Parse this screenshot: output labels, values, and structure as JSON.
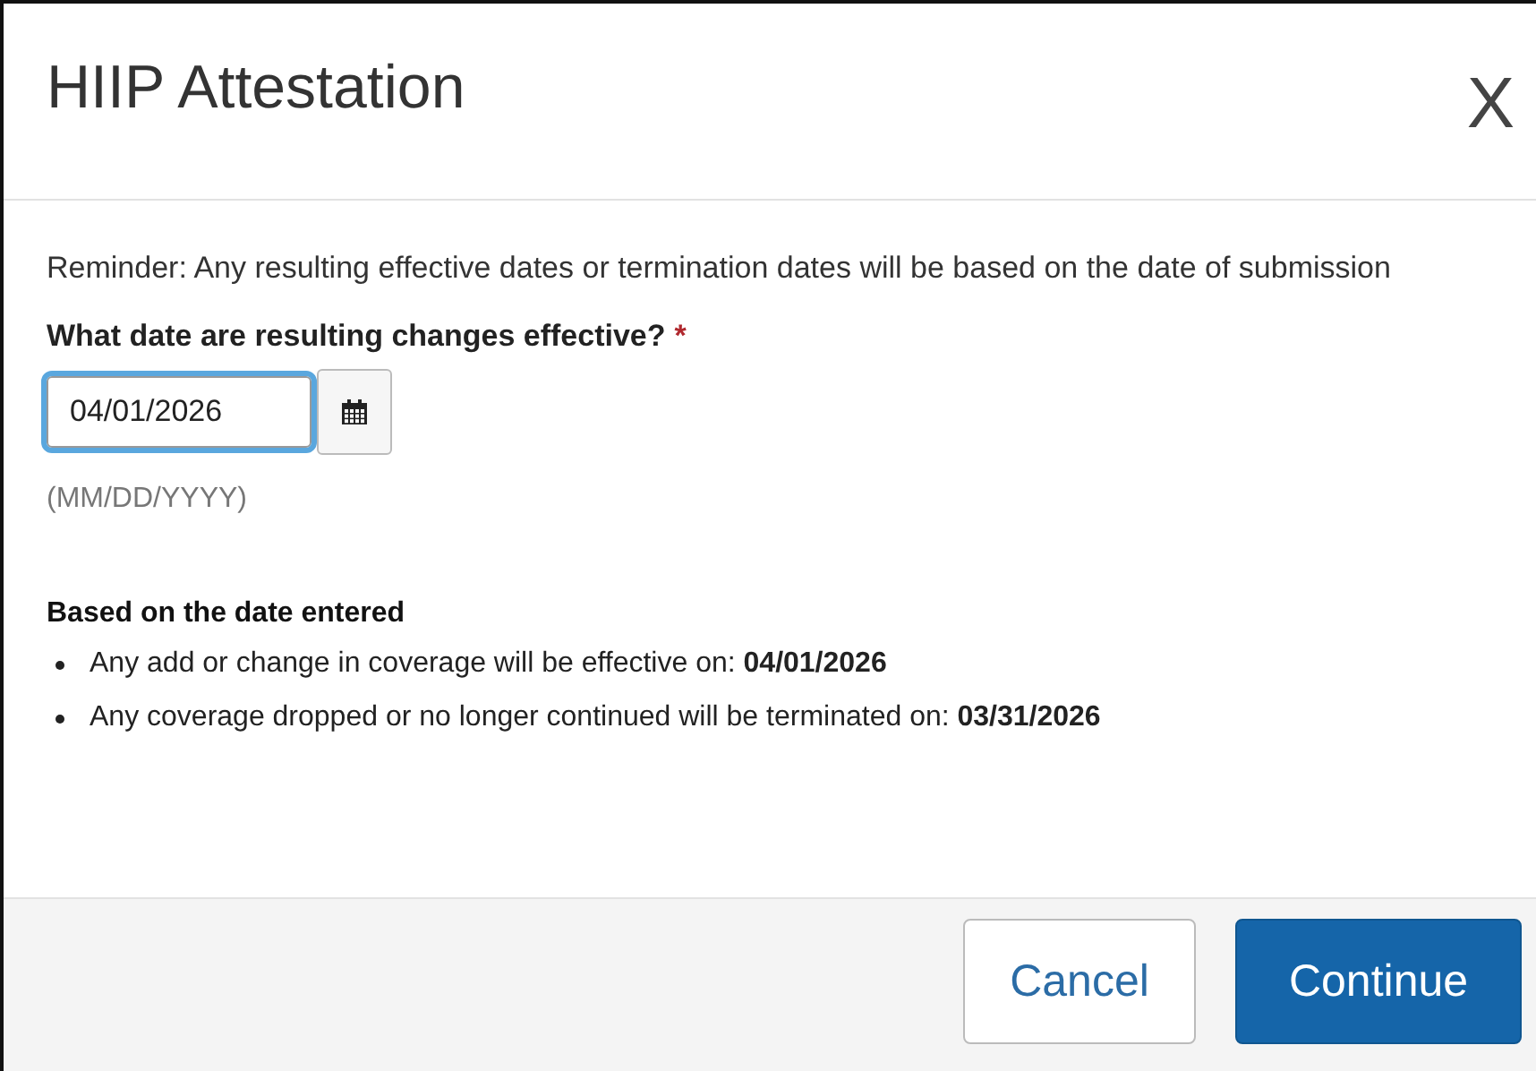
{
  "dialog": {
    "title": "HIIP Attestation",
    "close": "X"
  },
  "reminder": "Reminder: Any resulting effective dates or termination dates will be based on the date of submission",
  "date_field": {
    "label": "What date are resulting changes effective?",
    "required_mark": "*",
    "value": "04/01/2026",
    "focused": true,
    "hint": "(MM/DD/YYYY)"
  },
  "summary": {
    "heading": "Based on the date entered",
    "items": [
      "Any add or change in coverage will be effective on: **04/01/2026**",
      "Any coverage dropped or no longer continued will be terminated on: **03/31/2026**"
    ]
  },
  "buttons": [
    {
      "label": "Cancel",
      "kind": "secondary"
    },
    {
      "label": "Continue",
      "kind": "primary"
    }
  ]
}
